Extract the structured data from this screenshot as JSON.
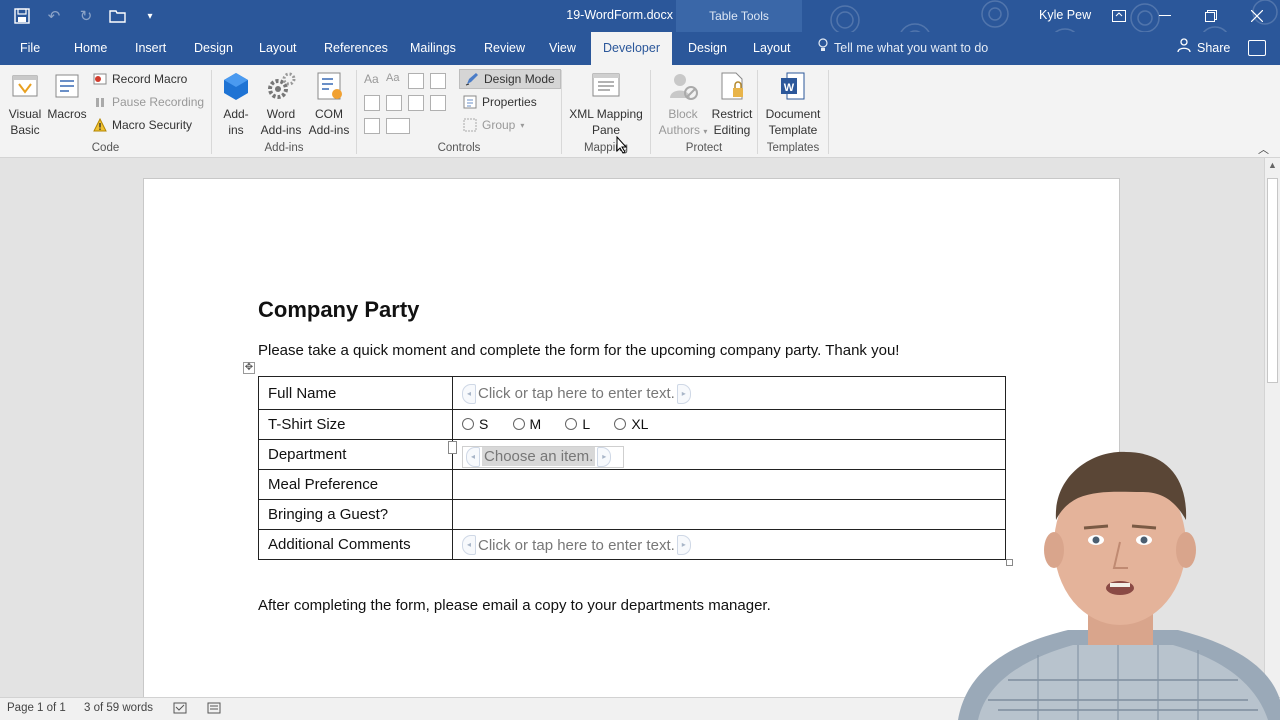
{
  "window": {
    "title": "19-WordForm.docx  -  Word",
    "context_tab_group": "Table Tools",
    "user_name": "Kyle Pew"
  },
  "quick_access": {
    "icons": [
      "save-icon",
      "undo-icon",
      "redo-icon",
      "open-icon",
      "customize-icon"
    ]
  },
  "tabs": {
    "file": "File",
    "home": "Home",
    "insert": "Insert",
    "design": "Design",
    "layout": "Layout",
    "references": "References",
    "mailings": "Mailings",
    "review": "Review",
    "view": "View",
    "developer": "Developer",
    "table_design": "Design",
    "table_layout": "Layout",
    "active": "Developer"
  },
  "tell_me": "Tell me what you want to do",
  "share": "Share",
  "ribbon": {
    "code": {
      "label": "Code",
      "visual_basic_1": "Visual",
      "visual_basic_2": "Basic",
      "macros": "Macros",
      "record_macro": "Record Macro",
      "pause_recording": "Pause Recording",
      "macro_security": "Macro Security"
    },
    "addins": {
      "label": "Add-ins",
      "addins_1": "Add-",
      "addins_2": "ins",
      "word_addins_1": "Word",
      "word_addins_2": "Add-ins",
      "com_addins_1": "COM",
      "com_addins_2": "Add-ins"
    },
    "controls": {
      "label": "Controls",
      "design_mode": "Design Mode",
      "properties": "Properties",
      "group": "Group"
    },
    "mapping": {
      "label": "Mapping",
      "xml_1": "XML Mapping",
      "xml_2": "Pane"
    },
    "protect": {
      "label": "Protect",
      "block_1": "Block",
      "block_2": "Authors",
      "restrict_1": "Restrict",
      "restrict_2": "Editing"
    },
    "templates": {
      "label": "Templates",
      "doc_1": "Document",
      "doc_2": "Template"
    }
  },
  "document": {
    "heading": "Company Party",
    "intro": "Please take a quick moment and complete the form for the upcoming company party. Thank you!",
    "rows": [
      {
        "label": "Full Name",
        "placeholder": "Click or tap here to enter text."
      },
      {
        "label": "T-Shirt Size",
        "options": [
          "S",
          "M",
          "L",
          "XL"
        ]
      },
      {
        "label": "Department",
        "placeholder": "Choose an item."
      },
      {
        "label": "Meal Preference",
        "placeholder": ""
      },
      {
        "label": "Bringing a Guest?",
        "placeholder": ""
      },
      {
        "label": "Additional Comments",
        "placeholder": "Click or tap here to enter text."
      }
    ],
    "footer": "After completing the form, please email a copy to your departments manager."
  },
  "status": {
    "page": "Page 1 of 1",
    "words": "3 of 59 words"
  },
  "colors": {
    "word_blue": "#2b579a",
    "ribbon_bg": "#f3f3f3",
    "table_tools": "#3a67a8"
  }
}
